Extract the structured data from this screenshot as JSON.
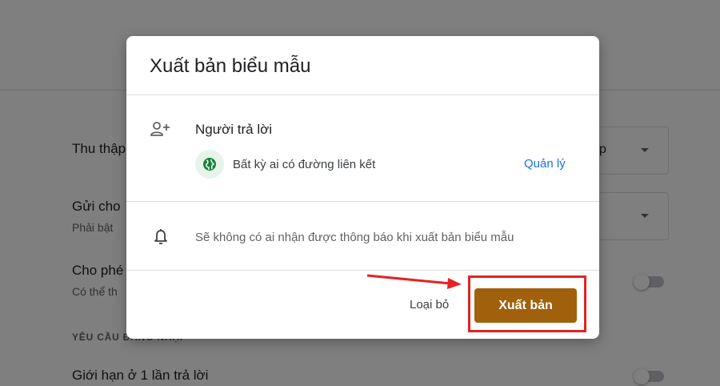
{
  "background": {
    "rows": [
      {
        "label": "Thu thập"
      },
      {
        "label": "Gửi cho",
        "sub": "Phải bật"
      },
      {
        "label": "Cho phé",
        "sub": "Có thể th"
      }
    ],
    "select_partial_text": "p",
    "section_heading": "YÊU CẦU ĐĂNG NHẬP",
    "last_row_label": "Giới hạn ở 1 lần trả lời"
  },
  "dialog": {
    "title": "Xuất bản biểu mẫu",
    "responders": {
      "heading": "Người trả lời",
      "access_text": "Bất kỳ ai có đường liên kết",
      "manage_label": "Quản lý"
    },
    "notification_text": "Sẽ không có ai nhận được thông báo khi xuất bản biểu mẫu",
    "discard_label": "Loại bỏ",
    "publish_label": "Xuất bản"
  },
  "colors": {
    "publish_button": "#a0600c",
    "link": "#1a73e8",
    "annotation": "#e52222",
    "globe": "#188038"
  },
  "icons": [
    "add-person-icon",
    "globe-icon",
    "bell-icon",
    "chevron-down-icon"
  ]
}
